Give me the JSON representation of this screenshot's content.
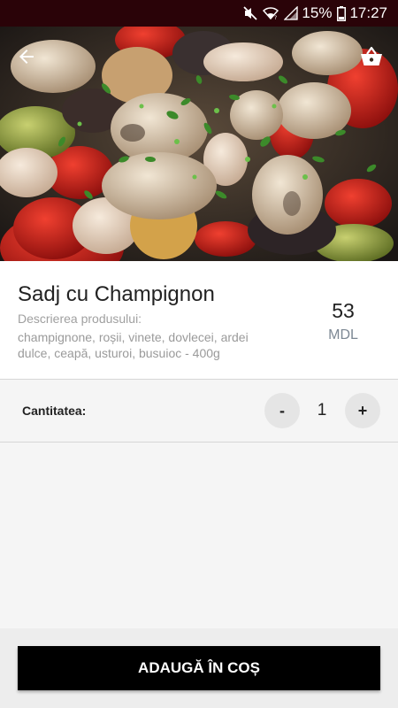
{
  "status_bar": {
    "battery_percent": "15%",
    "time": "17:27",
    "icons": [
      "mute-icon",
      "wifi-icon",
      "signal-icon",
      "battery-icon"
    ]
  },
  "header": {
    "back_icon": "arrow-left-icon",
    "cart_icon": "basket-icon"
  },
  "product": {
    "title": "Sadj cu Champignon",
    "description_label": "Descrierea produsului:",
    "description": "champignone, roșii, vinete, dovlecei, ardei dulce, ceapă, usturoi, busuioc - 400g",
    "price": "53",
    "currency": "MDL"
  },
  "quantity": {
    "label": "Cantitatea:",
    "minus_label": "-",
    "value": "1",
    "plus_label": "+"
  },
  "actions": {
    "add_to_cart_label": "ADAUGĂ ÎN COȘ"
  },
  "colors": {
    "status_bar": "#2a0308",
    "button": "#000000",
    "price_currency": "#7d8894"
  }
}
